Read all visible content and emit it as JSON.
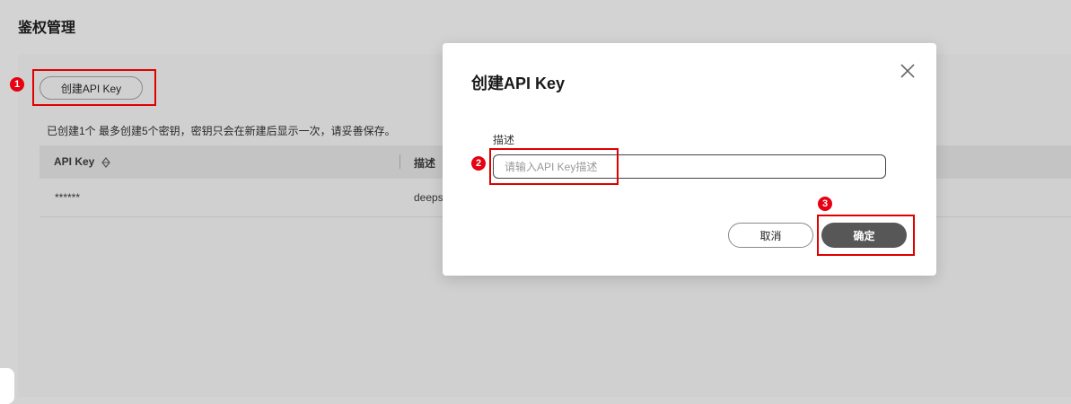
{
  "page": {
    "title": "鉴权管理",
    "create_button": "创建API Key",
    "info_text": "已创建1个  最多创建5个密钥，密钥只会在新建后显示一次，请妥善保存。",
    "table": {
      "headers": [
        "API Key",
        "描述"
      ],
      "rows": [
        {
          "key": "******",
          "desc": "deeps"
        }
      ]
    }
  },
  "dialog": {
    "title": "创建API Key",
    "description_label": "描述",
    "description_placeholder": "请输入API Key描述",
    "cancel_label": "取消",
    "confirm_label": "确定"
  },
  "annotations": {
    "markers": [
      "1",
      "2",
      "3"
    ],
    "color": "#e60012"
  },
  "icons": [
    "sort-icon",
    "close-icon"
  ]
}
